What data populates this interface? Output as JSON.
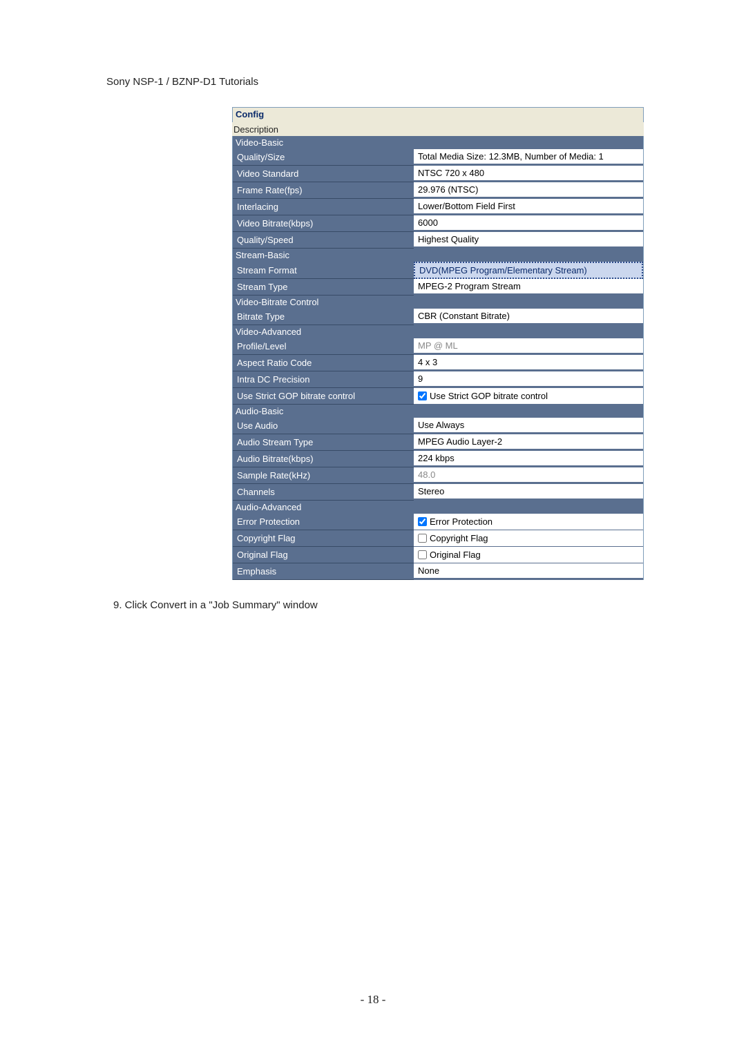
{
  "header": "Sony NSP-1 / BZNP-D1 Tutorials",
  "group_title": "Config",
  "description_label": "Description",
  "sections": {
    "video_basic": {
      "title": "Video-Basic",
      "rows": [
        {
          "label": "Quality/Size",
          "value": "Total Media Size: 12.3MB, Number of Media: 1"
        },
        {
          "label": "Video Standard",
          "value": "NTSC 720 x 480"
        },
        {
          "label": "Frame Rate(fps)",
          "value": "29.976 (NTSC)"
        },
        {
          "label": "Interlacing",
          "value": "Lower/Bottom Field First"
        },
        {
          "label": "Video Bitrate(kbps)",
          "value": "6000"
        },
        {
          "label": "Quality/Speed",
          "value": "Highest Quality"
        }
      ]
    },
    "stream_basic": {
      "title": "Stream-Basic",
      "rows": [
        {
          "label": "Stream Format",
          "value": "DVD(MPEG Program/Elementary Stream)"
        },
        {
          "label": "Stream Type",
          "value": "MPEG-2 Program Stream"
        }
      ]
    },
    "video_bitrate": {
      "title": "Video-Bitrate Control",
      "rows": [
        {
          "label": "Bitrate Type",
          "value": "CBR (Constant Bitrate)"
        }
      ]
    },
    "video_advanced": {
      "title": "Video-Advanced",
      "rows": [
        {
          "label": "Profile/Level",
          "value": "MP @ ML"
        },
        {
          "label": "Aspect Ratio Code",
          "value": "4 x 3"
        },
        {
          "label": "Intra DC Precision",
          "value": "9"
        },
        {
          "label": "Use Strict GOP bitrate control",
          "value": "Use Strict GOP bitrate control"
        }
      ]
    },
    "audio_basic": {
      "title": "Audio-Basic",
      "rows": [
        {
          "label": "Use Audio",
          "value": "Use Always"
        },
        {
          "label": "Audio Stream Type",
          "value": "MPEG Audio Layer-2"
        },
        {
          "label": "Audio Bitrate(kbps)",
          "value": "224 kbps"
        },
        {
          "label": "Sample Rate(kHz)",
          "value": "48.0"
        },
        {
          "label": "Channels",
          "value": "Stereo"
        }
      ]
    },
    "audio_advanced": {
      "title": "Audio-Advanced",
      "rows": [
        {
          "label": "Error Protection",
          "value": "Error Protection"
        },
        {
          "label": "Copyright Flag",
          "value": "Copyright Flag"
        },
        {
          "label": "Original Flag",
          "value": "Original Flag"
        },
        {
          "label": "Emphasis",
          "value": "None"
        }
      ]
    }
  },
  "caption": "9. Click Convert in a \"Job Summary\" window",
  "page_number": "- 18 -"
}
